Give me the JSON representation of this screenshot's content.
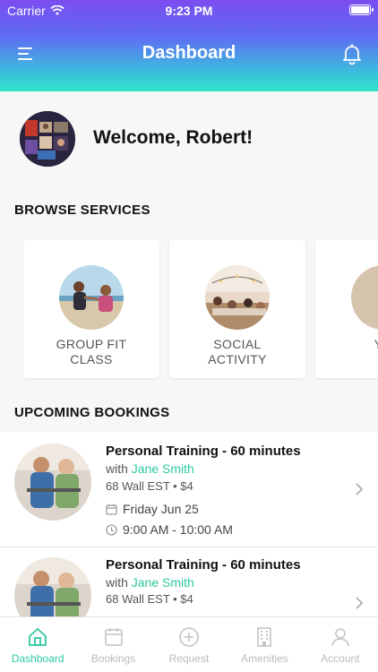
{
  "status_bar": {
    "carrier": "Carrier",
    "time": "9:23 PM"
  },
  "header": {
    "title": "Dashboard"
  },
  "welcome": {
    "text": "Welcome, Robert!"
  },
  "browse": {
    "title": "BROWSE SERVICES",
    "services": [
      {
        "line1": "GROUP FIT",
        "line2": "CLASS"
      },
      {
        "line1": "SOCIAL",
        "line2": "ACTIVITY"
      },
      {
        "line1": "YO",
        "line2": ""
      }
    ]
  },
  "bookings": {
    "title": "UPCOMING BOOKINGS",
    "items": [
      {
        "title": "Personal Training - 60 minutes",
        "with": "with",
        "trainer": "Jane Smith",
        "location": "68 Wall EST • $4",
        "date": "Friday Jun 25",
        "time": "9:00 AM - 10:00 AM"
      },
      {
        "title": "Personal Training - 60 minutes",
        "with": "with",
        "trainer": "Jane Smith",
        "location": "68 Wall EST • $4"
      }
    ]
  },
  "tabs": [
    {
      "label": "Dashboard",
      "icon": "home-icon"
    },
    {
      "label": "Bookings",
      "icon": "calendar-icon"
    },
    {
      "label": "Request",
      "icon": "plus-circle-icon"
    },
    {
      "label": "Amenities",
      "icon": "building-icon"
    },
    {
      "label": "Account",
      "icon": "person-icon"
    }
  ],
  "colors": {
    "accent": "#2ec8a0",
    "gradient_top": "#7b4df0",
    "gradient_bottom": "#2fe5c8"
  }
}
